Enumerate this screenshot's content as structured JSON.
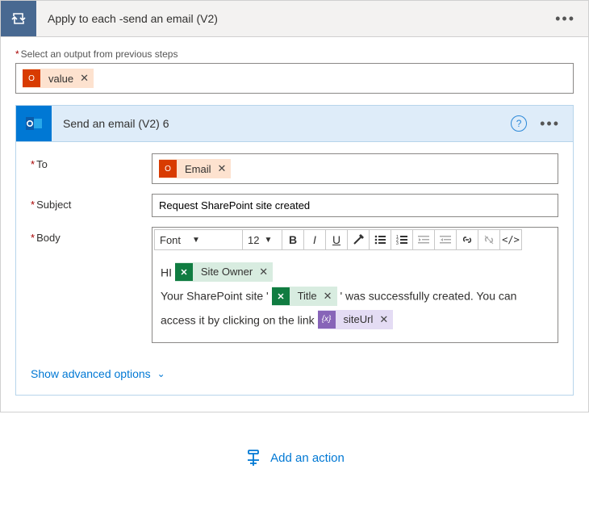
{
  "outer": {
    "title": "Apply to each -send an email (V2)",
    "fieldLabel": "Select an output from previous steps",
    "token": {
      "label": "value",
      "icon": "O"
    }
  },
  "inner": {
    "title": "Send an email (V2) 6",
    "labels": {
      "to": "To",
      "subject": "Subject",
      "body": "Body"
    },
    "toToken": {
      "label": "Email",
      "icon": "O"
    },
    "subject": "Request SharePoint site created",
    "rte": {
      "font": "Font",
      "size": "12"
    },
    "body": {
      "greet": "HI",
      "siteOwnerToken": "Site Owner",
      "line2a": "Your SharePoint site '",
      "titleToken": "Title",
      "line2b": "' was successfully created. You can access",
      "line3a": "it by clicking on the link",
      "siteUrlToken": "siteUrl"
    },
    "advanced": "Show advanced options"
  },
  "addAction": "Add an action"
}
